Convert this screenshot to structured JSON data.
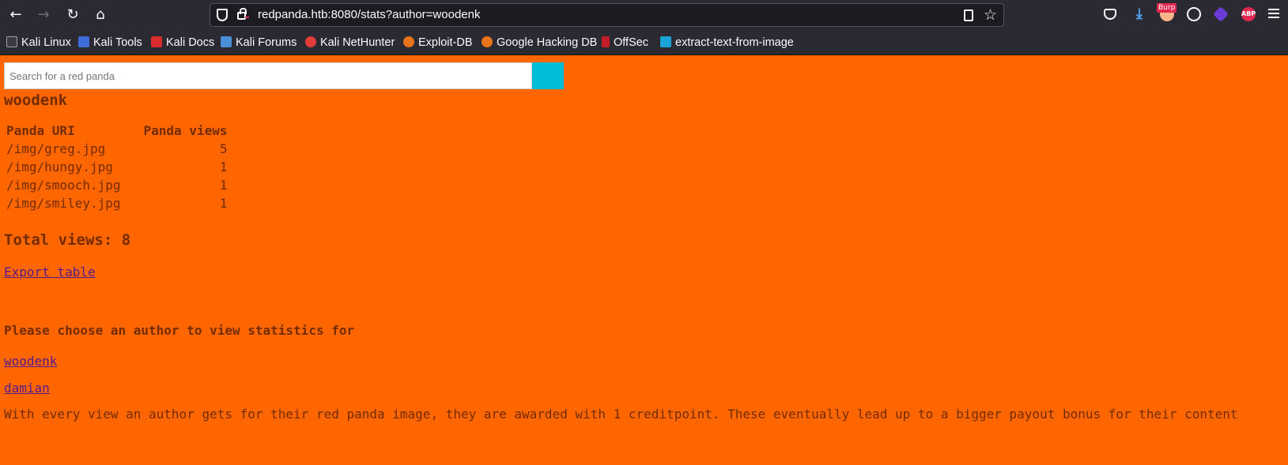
{
  "browser": {
    "url": "redpanda.htb:8080/stats?author=woodenk",
    "burp_badge": "Burp",
    "abp_label": "ABP"
  },
  "bookmarks": [
    {
      "label": "Kali Linux",
      "icon": "kali-dragon-icon"
    },
    {
      "label": "Kali Tools",
      "icon": "kali-tools-icon"
    },
    {
      "label": "Kali Docs",
      "icon": "kali-docs-icon"
    },
    {
      "label": "Kali Forums",
      "icon": "kali-forums-icon"
    },
    {
      "label": "Kali NetHunter",
      "icon": "nethunter-icon"
    },
    {
      "label": "Exploit-DB",
      "icon": "exploit-db-icon"
    },
    {
      "label": "Google Hacking DB",
      "icon": "ghdb-icon"
    },
    {
      "label": "OffSec",
      "icon": "offsec-icon"
    },
    {
      "label": "extract-text-from-image",
      "icon": "b-icon"
    }
  ],
  "search": {
    "placeholder": "Search for a red panda",
    "value": ""
  },
  "author": "woodenk",
  "table": {
    "headers": [
      "Panda URI",
      "Panda views"
    ],
    "rows": [
      [
        "/img/greg.jpg",
        "5"
      ],
      [
        "/img/hungy.jpg",
        "1"
      ],
      [
        "/img/smooch.jpg",
        "1"
      ],
      [
        "/img/smiley.jpg",
        "1"
      ]
    ]
  },
  "total_views": "Total views: 8",
  "export_label": "Export table",
  "choose_heading": "Please choose an author to view statistics for",
  "author_links": [
    "woodenk",
    "damian"
  ],
  "info_text": "With every view an author gets for their red panda image, they are awarded with 1 creditpoint. These eventually lead up to a bigger payout bonus for their content",
  "colors": {
    "page_background": "#ff6600",
    "text": "#732c00",
    "link": "#551a8b",
    "search_button": "#00bcd4",
    "browser_chrome": "#2b2a33"
  }
}
